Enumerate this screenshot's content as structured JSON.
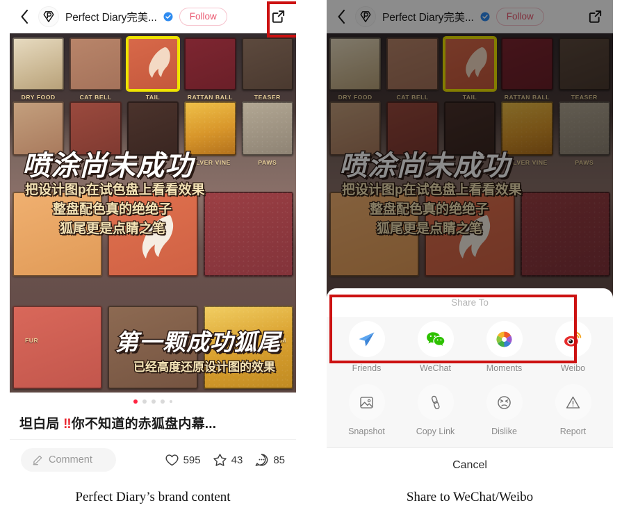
{
  "figure": {
    "caption_left": "Perfect Diary’s brand content",
    "caption_right": "Share to WeChat/Weibo"
  },
  "header": {
    "back_icon": "back-chevron-icon",
    "avatar_icon": "perfect-diary-logo-icon",
    "account_name": "Perfect Diary完美...",
    "verified_icon": "verified-badge-icon",
    "follow_label": "Follow",
    "share_icon": "share-external-link-icon"
  },
  "post": {
    "headline_top": "喷涂尚未成功",
    "sub_lines_top": [
      "把设计图p在试色盘上看看效果",
      "整盘配色真的绝绝子",
      "狐尾更是点睛之笔"
    ],
    "headline_bottom": "第一颗成功狐尾",
    "sub_bottom": "已经高度还原设计图的效果",
    "swatch_labels_row1": [
      "DRY FOOD",
      "CAT BELL",
      "TAIL",
      "RATTAN BALL",
      "TEASER"
    ],
    "swatch_labels_row2": [
      "",
      "",
      "",
      "SILVER VINE",
      "PAWS"
    ],
    "swatch_labels_row3": [
      "FUR",
      "",
      "",
      "",
      "RM"
    ],
    "title": "坦白局 ",
    "title_bangs": "‼",
    "title_rest": "你不知道的赤狐盘内幕...",
    "pagination_total": 5,
    "pagination_active": 1
  },
  "actions": {
    "comment_icon": "pencil-edit-icon",
    "comment_placeholder": "Comment",
    "like_icon": "heart-icon",
    "like_count": "595",
    "collect_icon": "star-icon",
    "collect_count": "43",
    "comment_count_icon": "speech-bubble-icon",
    "comment_count": "85"
  },
  "share_sheet": {
    "title": "Share To",
    "row1": [
      {
        "label": "Friends",
        "icon": "paper-plane-icon"
      },
      {
        "label": "WeChat",
        "icon": "wechat-icon"
      },
      {
        "label": "Moments",
        "icon": "wechat-moments-icon"
      },
      {
        "label": "Weibo",
        "icon": "weibo-icon"
      }
    ],
    "row2": [
      {
        "label": "Snapshot",
        "icon": "image-picture-icon"
      },
      {
        "label": "Copy Link",
        "icon": "link-chain-icon"
      },
      {
        "label": "Dislike",
        "icon": "frowning-face-icon"
      },
      {
        "label": "Report",
        "icon": "warning-triangle-icon"
      }
    ],
    "cancel_label": "Cancel"
  },
  "colors": {
    "accent_red": "#ff2442",
    "follow_pink": "#ea5a71",
    "annotation_red": "#cc1111",
    "verified_blue": "#2e8bf0",
    "friends_blue": "#4a9cf0",
    "wechat_green": "#2dc100",
    "weibo_red": "#e62d2d",
    "weibo_orange": "#f5a623"
  }
}
